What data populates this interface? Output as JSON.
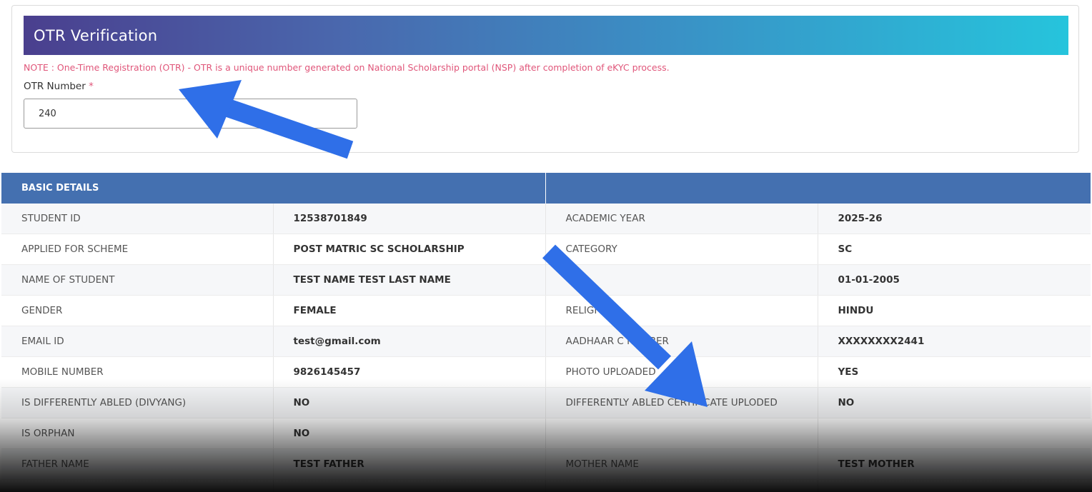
{
  "otr": {
    "title": "OTR Verification",
    "note": "NOTE : One-Time Registration (OTR) - OTR is a unique number generated on National Scholarship portal (NSP) after completion of eKYC process.",
    "label": "OTR Number",
    "required_mark": "*",
    "value": "240"
  },
  "basic_details": {
    "header": "BASIC DETAILS",
    "header_right": "",
    "rows": [
      {
        "l1": "STUDENT ID",
        "v1": "12538701849",
        "l2": "ACADEMIC YEAR",
        "v2": "2025-26"
      },
      {
        "l1": "APPLIED FOR SCHEME",
        "v1": "POST MATRIC SC SCHOLARSHIP",
        "l2": "CATEGORY",
        "v2": "SC"
      },
      {
        "l1": "NAME OF STUDENT",
        "v1": "TEST NAME TEST LAST NAME",
        "l2": "",
        "v2": "01-01-2005"
      },
      {
        "l1": "GENDER",
        "v1": "FEMALE",
        "l2": "RELIGI",
        "v2": "HINDU"
      },
      {
        "l1": "EMAIL ID",
        "v1": "test@gmail.com",
        "l2": "AADHAAR C      NUMBER",
        "v2": "XXXXXXXX2441"
      },
      {
        "l1": "MOBILE NUMBER",
        "v1": "9826145457",
        "l2": "PHOTO UPLOADED",
        "v2": "YES"
      },
      {
        "l1": "IS DIFFERENTLY ABLED (DIVYANG)",
        "v1": "NO",
        "l2": "DIFFERENTLY ABLED CERTIFICATE UPLODED",
        "v2": "NO"
      },
      {
        "l1": "IS ORPHAN",
        "v1": "NO",
        "l2": "",
        "v2": ""
      },
      {
        "l1": "FATHER NAME",
        "v1": "TEST FATHER",
        "l2": "MOTHER NAME",
        "v2": "TEST MOTHER"
      },
      {
        "l1": "",
        "v1": "",
        "l2": "",
        "v2": ""
      }
    ]
  },
  "colors": {
    "header_blue": "#4470b0",
    "note_pink": "#e0567a",
    "arrow_blue": "#2f6fe8"
  }
}
